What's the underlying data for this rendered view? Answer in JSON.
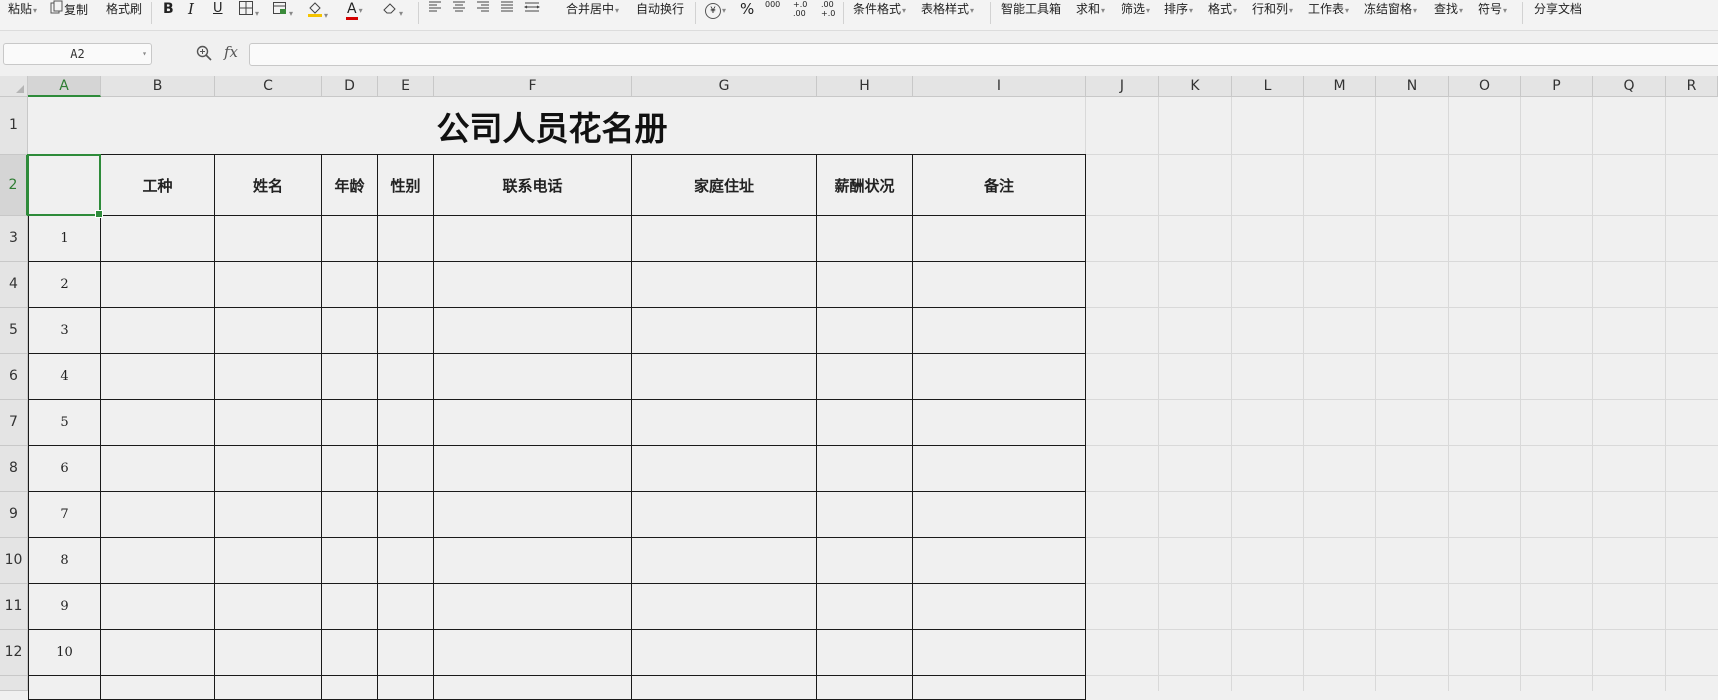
{
  "toolbar": {
    "paste_label": "粘贴",
    "copy_label": "复制",
    "format_painter_label": "格式刷",
    "bold_label": "B",
    "italic_label": "I",
    "underline_label": "U",
    "font_color_label": "A",
    "merge_center_label": "合并居中",
    "wrap_text_label": "自动换行",
    "currency_label": "¥",
    "percent_label": "%",
    "thousands_label": "000",
    "inc_decimal_label": "+.0 .00",
    "dec_decimal_label": ".00 +.0",
    "cond_format_label": "条件格式",
    "table_style_label": "表格样式",
    "smart_toolbox_label": "智能工具箱",
    "sum_label": "求和",
    "filter_label": "筛选",
    "sort_label": "排序",
    "format_label": "格式",
    "rows_cols_label": "行和列",
    "worksheet_label": "工作表",
    "freeze_label": "冻结窗格",
    "find_label": "查找",
    "symbol_label": "符号",
    "share_label": "分享文档"
  },
  "formula_bar": {
    "name_box": "A2",
    "fx_label": "fx",
    "value": ""
  },
  "columns": [
    "A",
    "B",
    "C",
    "D",
    "E",
    "F",
    "G",
    "H",
    "I",
    "J",
    "K",
    "L",
    "M",
    "N",
    "O",
    "P",
    "Q",
    "R"
  ],
  "rows": [
    "1",
    "2",
    "3",
    "4",
    "5",
    "6",
    "7",
    "8",
    "9",
    "10",
    "11",
    "12"
  ],
  "sheet": {
    "title": "公司人员花名册",
    "headers": [
      "",
      "工种",
      "姓名",
      "年龄",
      "性别",
      "联系电话",
      "家庭住址",
      "薪酬状况",
      "备注"
    ],
    "row_numbers": [
      "1",
      "2",
      "3",
      "4",
      "5",
      "6",
      "7",
      "8",
      "9",
      "10"
    ]
  },
  "selection": {
    "active_cell": "A2",
    "active_column": "A",
    "active_row": "2",
    "accent_color": "#2e8b3a"
  }
}
